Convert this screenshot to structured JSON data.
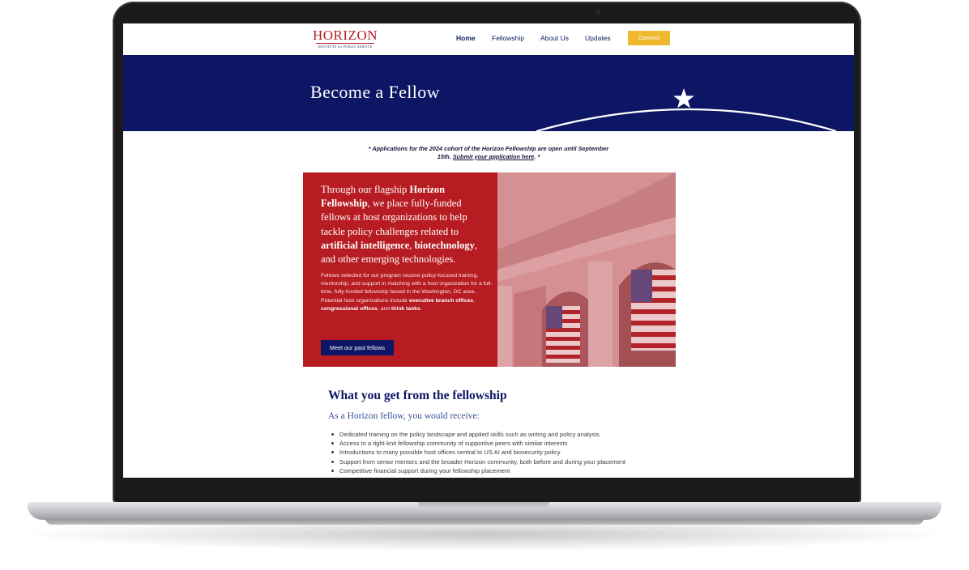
{
  "nav": {
    "logo_text": "HORIZON",
    "logo_subtitle": "INSTITUTE for PUBLIC SERVICE",
    "links": [
      "Home",
      "Fellowship",
      "About Us",
      "Updates"
    ],
    "connect_label": "Connect"
  },
  "banner": {
    "title": "Become a Fellow"
  },
  "notice": {
    "text": "* Applications for the 2024 cohort of the Horizon Fellowship are open until September 15th. ",
    "link_text": "Submit your application here",
    "suffix": ". *"
  },
  "promo": {
    "lead": {
      "p1": "Through our flagship ",
      "b1": "Horizon Fellowship",
      "p2": ", we place fully-funded fellows at host organizations to help tackle policy challenges related to ",
      "b2": "artificial intelligence",
      "p3": ", ",
      "b3": "biotechnology",
      "p4": ", and other emerging technologies."
    },
    "body": {
      "p1": "Fellows selected for our program receive policy-focused training, mentorship, and support in matching with a host organization for a full-time, fully-funded fellowship based in the Washington, DC area. Potential host organizations include ",
      "b1": "executive branch offices",
      "p2": ", ",
      "b2": "congressional offices",
      "p3": ", and ",
      "b3": "think tanks",
      "p4": "."
    },
    "button_label": "Meet our past fellows"
  },
  "benefits_section": {
    "title": "What you get from the fellowship",
    "intro": "As a Horizon fellow, you would receive:",
    "items": [
      "Dedicated training on the policy landscape and applied skills such as writing and policy analysis",
      "Access to a tight-knit fellowship community of supportive peers with similar interests",
      "Introductions to many possible host offices central to US AI and biosecurity policy",
      "Support from senior mentors and the broader Horizon community, both before and during your placement",
      "Competitive financial support during your fellowship placement"
    ]
  },
  "colors": {
    "navy": "#0c1664",
    "red": "#b61c21",
    "gold": "#eeb92f"
  },
  "icons": [
    "star-icon",
    "building-flags-image"
  ]
}
